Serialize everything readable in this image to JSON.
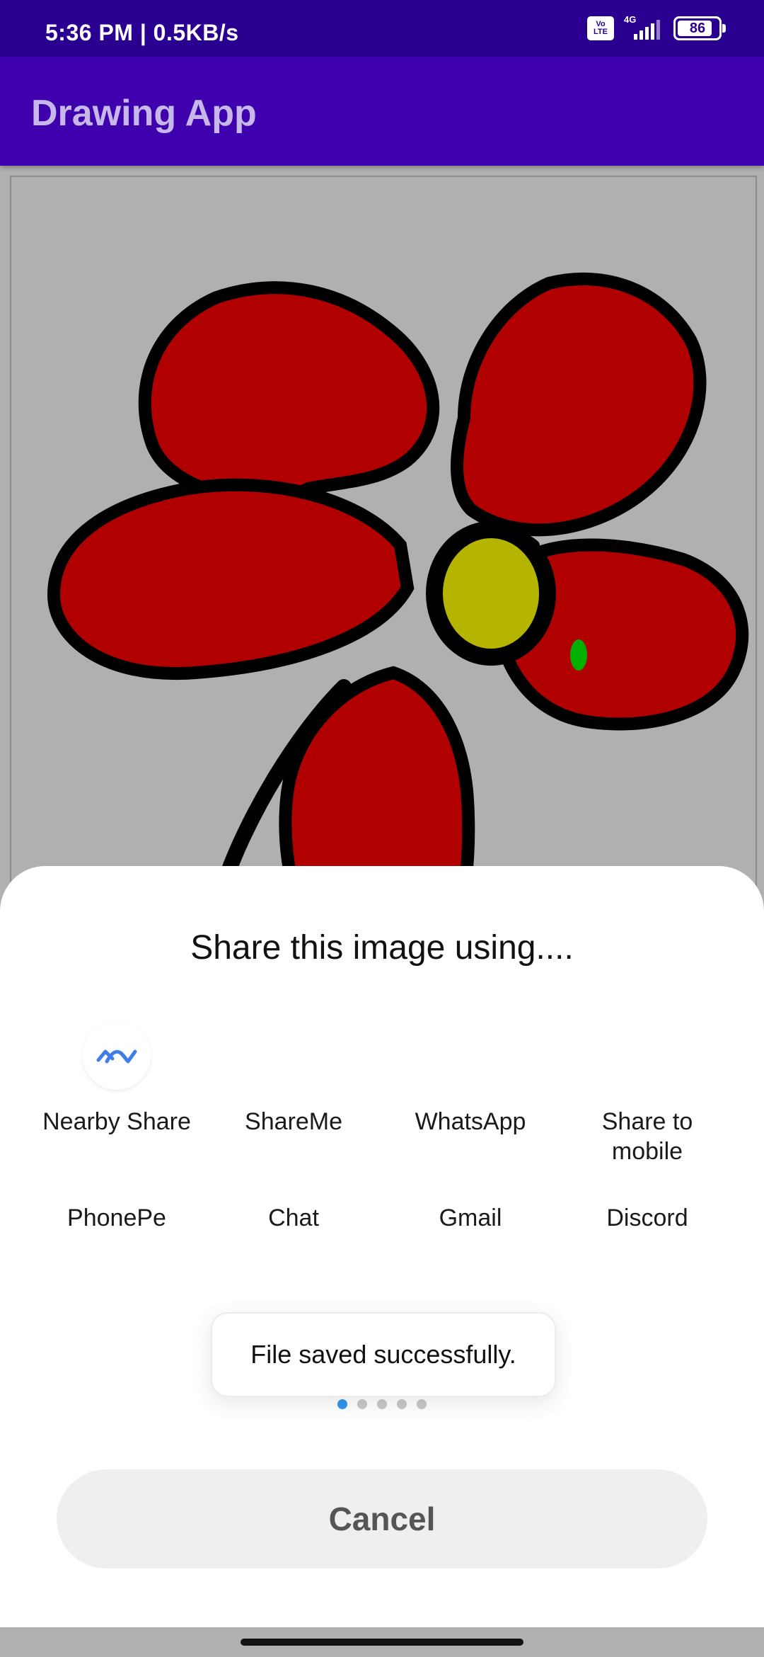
{
  "status_bar": {
    "time_speed": "5:36 PM | 0.5KB/s",
    "volte": "Vo LTE",
    "network": "4G",
    "battery": "86"
  },
  "app_bar": {
    "title": "Drawing App"
  },
  "share_sheet": {
    "title": "Share this image using....",
    "apps": [
      {
        "label": "Nearby Share",
        "icon": "nearby-share-icon"
      },
      {
        "label": "ShareMe",
        "icon": ""
      },
      {
        "label": "WhatsApp",
        "icon": ""
      },
      {
        "label": "Share to mobile",
        "icon": ""
      },
      {
        "label": "PhonePe",
        "icon": ""
      },
      {
        "label": "Chat",
        "icon": ""
      },
      {
        "label": "Gmail",
        "icon": ""
      },
      {
        "label": "Discord",
        "icon": ""
      }
    ],
    "page_count": 5,
    "active_page": 1,
    "cancel_label": "Cancel"
  },
  "toast": {
    "message": "File saved successfully."
  },
  "colors": {
    "status_bar": "#2a0090",
    "app_bar": "#3f00ad",
    "petal_red": "#b00000",
    "center_yellow": "#b5b500",
    "dot_green": "#00b000",
    "accent_blue": "#3296f0"
  }
}
